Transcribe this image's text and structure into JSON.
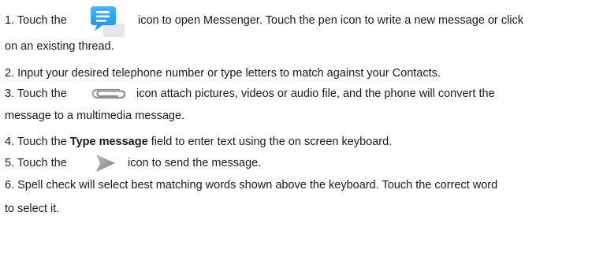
{
  "steps": [
    {
      "number": "1.",
      "text_before_icon": "Touch the",
      "icon": "messenger-icon",
      "text_after_icon": "icon to open Messenger. Touch the pen icon to write a new message or click",
      "continuation": "on an existing thread."
    },
    {
      "number": "2.",
      "text": "Input your desired telephone number or type letters to match against your Contacts."
    },
    {
      "number": "3.",
      "text_before_icon": "Touch the",
      "icon": "paperclip-icon",
      "text_after_icon": "icon attach pictures, videos or audio file, and the phone will convert the",
      "continuation": "message to a multimedia message."
    },
    {
      "number": "4.",
      "text_before_bold": "Touch the",
      "bold": "Type message",
      "text_after_bold": "field to enter text using the on screen keyboard."
    },
    {
      "number": "5.",
      "text_before_icon": "Touch the",
      "icon": "send-arrow-icon",
      "text_after_icon": "icon to send the message."
    },
    {
      "number": "6.",
      "text": "Spell check will select best matching words shown above the keyboard. Touch the correct word",
      "continuation": "to select it."
    }
  ]
}
